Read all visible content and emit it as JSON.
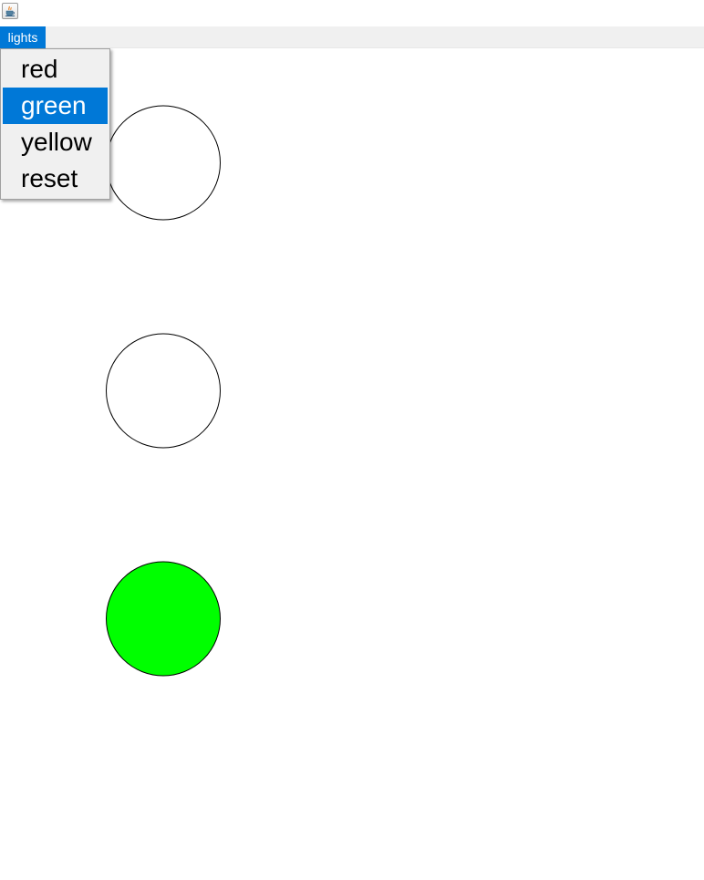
{
  "app": {
    "icon": "java-cup-icon"
  },
  "menubar": {
    "menu_label": "lights"
  },
  "menu": {
    "items": [
      {
        "label": "red",
        "selected": false
      },
      {
        "label": "green",
        "selected": true
      },
      {
        "label": "yellow",
        "selected": false
      },
      {
        "label": "reset",
        "selected": false
      }
    ]
  },
  "lights": [
    {
      "position": "top",
      "color": "red",
      "lit": false
    },
    {
      "position": "middle",
      "color": "yellow",
      "lit": false
    },
    {
      "position": "bottom",
      "color": "green",
      "lit": true
    }
  ],
  "colors": {
    "accent": "#0078d7",
    "menubar_bg": "#f0f0f0",
    "lit_green": "#00ff00",
    "light_outline": "#000000",
    "unlit_fill": "#ffffff"
  }
}
